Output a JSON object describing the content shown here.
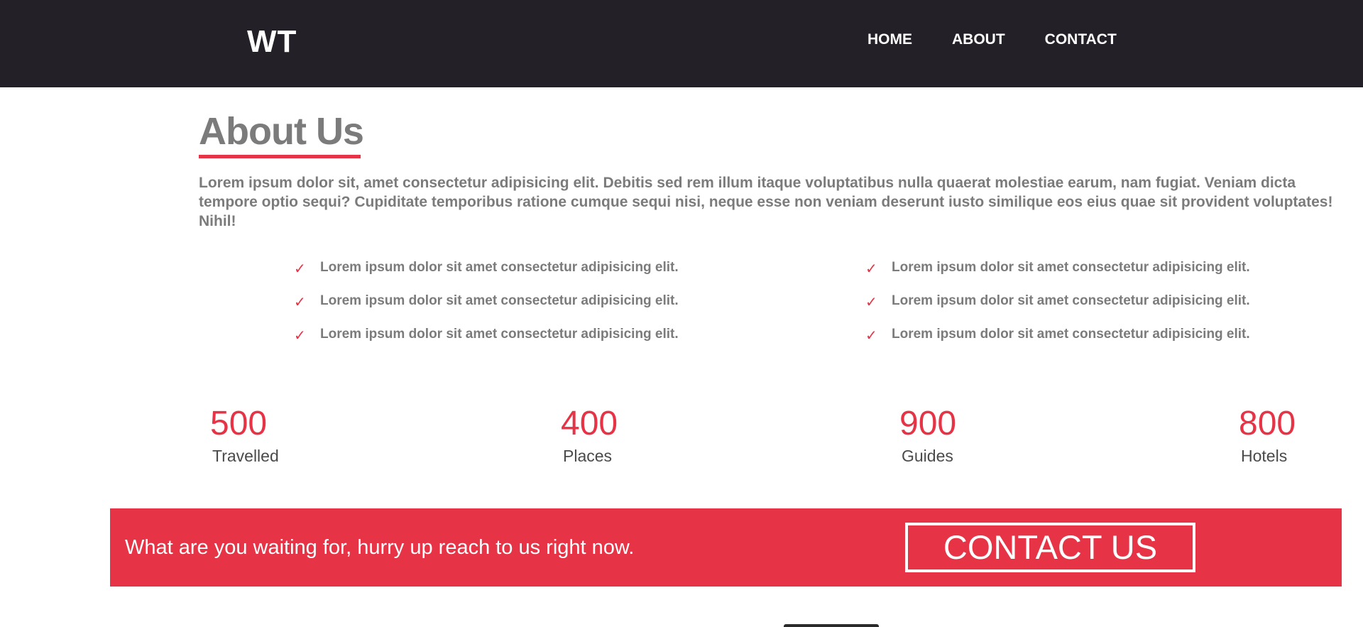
{
  "header": {
    "logo": "WT",
    "nav": [
      "HOME",
      "ABOUT",
      "CONTACT"
    ]
  },
  "about": {
    "title": "About Us",
    "paragraph": "Lorem ipsum dolor sit, amet consectetur adipisicing elit. Debitis sed rem illum itaque voluptatibus nulla quaerat molestiae earum, nam fugiat. Veniam dicta tempore optio sequi? Cupiditate temporibus ratione cumque sequi nisi, neque esse non veniam deserunt iusto similique eos eius quae sit provident voluptates! Nihil!",
    "check_icon": "✓",
    "list_left": [
      "Lorem ipsum dolor sit amet consectetur adipisicing elit.",
      "Lorem ipsum dolor sit amet consectetur adipisicing elit.",
      "Lorem ipsum dolor sit amet consectetur adipisicing elit."
    ],
    "list_right": [
      "Lorem ipsum dolor sit amet consectetur adipisicing elit.",
      "Lorem ipsum dolor sit amet consectetur adipisicing elit.",
      "Lorem ipsum dolor sit amet consectetur adipisicing elit."
    ]
  },
  "stats": [
    {
      "number": "500",
      "label": "Travelled"
    },
    {
      "number": "400",
      "label": "Places"
    },
    {
      "number": "900",
      "label": "Guides"
    },
    {
      "number": "800",
      "label": "Hotels"
    }
  ],
  "cta": {
    "text": "What are you waiting for, hurry up reach to us right now.",
    "button": "CONTACT US"
  },
  "colors": {
    "accent": "#e63346",
    "navbar_bg": "#232127",
    "text_gray": "#7b7b7b"
  }
}
